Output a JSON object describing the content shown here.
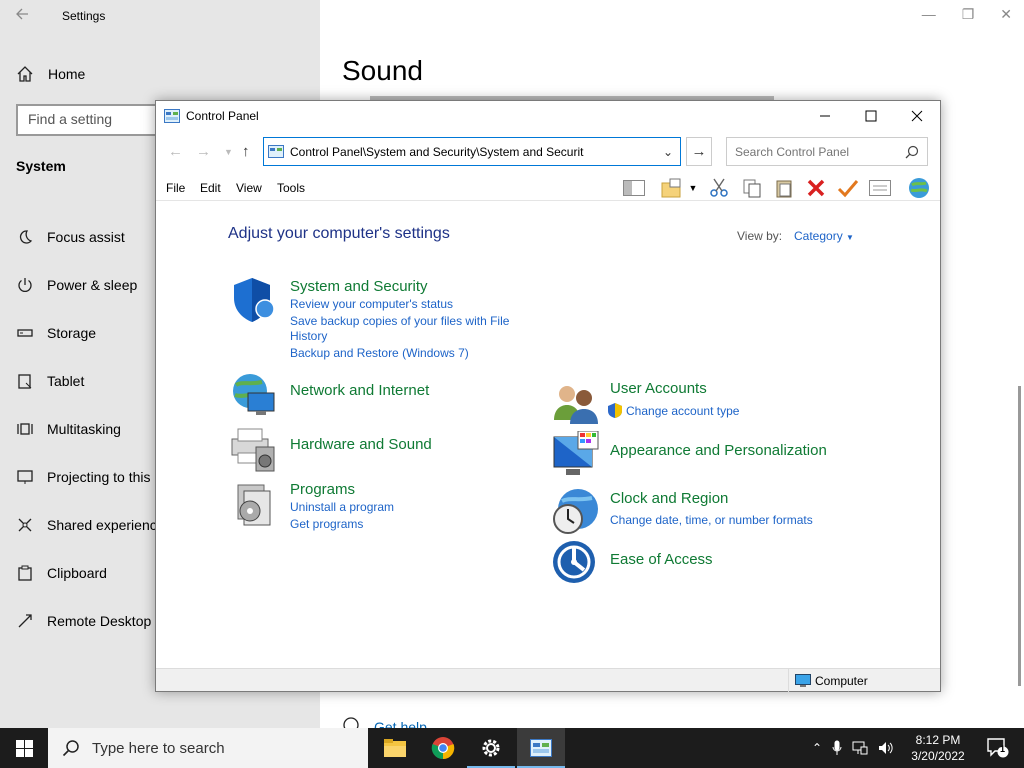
{
  "settings": {
    "title": "Settings",
    "home_label": "Home",
    "find_placeholder": "Find a setting",
    "section": "System",
    "nav": [
      {
        "label": "Focus assist",
        "icon": "moon-icon"
      },
      {
        "label": "Power & sleep",
        "icon": "power-icon"
      },
      {
        "label": "Storage",
        "icon": "storage-icon"
      },
      {
        "label": "Tablet",
        "icon": "tablet-icon"
      },
      {
        "label": "Multitasking",
        "icon": "multitasking-icon"
      },
      {
        "label": "Projecting to this",
        "icon": "projecting-icon"
      },
      {
        "label": "Shared experience",
        "icon": "shared-experience-icon"
      },
      {
        "label": "Clipboard",
        "icon": "clipboard-icon"
      },
      {
        "label": "Remote Desktop",
        "icon": "remote-desktop-icon"
      }
    ],
    "page_title": "Sound",
    "get_help": "Get help"
  },
  "control_panel": {
    "title": "Control Panel",
    "address": "Control Panel\\System and Security\\System and Securit",
    "search_placeholder": "Search Control Panel",
    "menu": [
      "File",
      "Edit",
      "View",
      "Tools"
    ],
    "heading": "Adjust your computer's settings",
    "view_by_label": "View by:",
    "view_by_value": "Category",
    "categories": {
      "system_security": {
        "title": "System and Security",
        "links": [
          "Review your computer's status",
          "Save backup copies of your files with File",
          "History",
          "Backup and Restore (Windows 7)"
        ]
      },
      "network": {
        "title": "Network and Internet"
      },
      "hardware": {
        "title": "Hardware and Sound"
      },
      "programs": {
        "title": "Programs",
        "links": [
          "Uninstall a program",
          "Get programs"
        ]
      },
      "user_accounts": {
        "title": "User Accounts",
        "links": [
          "Change account type"
        ]
      },
      "appearance": {
        "title": "Appearance and Personalization"
      },
      "clock": {
        "title": "Clock and Region",
        "links": [
          "Change date, time, or number formats"
        ]
      },
      "ease": {
        "title": "Ease of Access"
      }
    },
    "status_location": "Computer"
  },
  "taskbar": {
    "search_placeholder": "Type here to search",
    "time": "8:12 PM",
    "date": "3/20/2022",
    "notification_count": "1"
  },
  "colors": {
    "category_title": "#0f7a34",
    "link": "#1e64c8",
    "heading": "#1e3287",
    "taskbar": "#1c1c1c"
  }
}
